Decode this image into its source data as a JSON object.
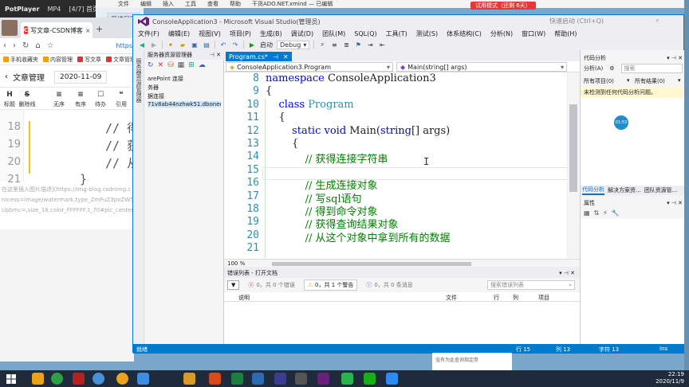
{
  "potplayer": {
    "name": "PotPlayer",
    "format": "MP4",
    "episode": "[4/7] 首页 -"
  },
  "mindmap": {
    "menus": [
      "文件",
      "编辑",
      "插入",
      "工具",
      "查看",
      "帮助"
    ],
    "file": "干货ADO.NET.xmind — 已编辑",
    "trial": "试用模式（还剩 6天）",
    "chip": "思维导图"
  },
  "browser": {
    "tab_title": "写文章-CSDN博客",
    "tab_close": "×",
    "new_tab": "+",
    "url": "https",
    "nav_icons": [
      "‹",
      "›",
      "↻",
      "⌂",
      "☆"
    ],
    "bookmarks": [
      "手机收藏夹",
      "内容管理",
      "写文章",
      "文章管理"
    ],
    "article_label": "文章管理",
    "back_symbol": "‹",
    "date": "2020-11-09",
    "tools": [
      {
        "icon": "H",
        "label": "标题"
      },
      {
        "icon": "S",
        "label": "删除线"
      },
      {
        "icon": "≡",
        "label": "无序"
      },
      {
        "icon": "≡",
        "label": "有序"
      },
      {
        "icon": "☐",
        "label": "待办"
      },
      {
        "icon": "❝",
        "label": "引用"
      }
    ],
    "editor_lines": [
      {
        "num": "18",
        "code": "// 得"
      },
      {
        "num": "19",
        "code": "// 获"
      },
      {
        "num": "20",
        "code": "// 从"
      },
      {
        "num": "21",
        "code": "}"
      }
    ],
    "md_lines": [
      "在这里插入图片描述](https://img-blog.csdnimg.c",
      "rocess=image/watermark,type_ZmFuZ3poZW5n",
      "Upbmc=,size_16,color_FFFFFF,t_70#pic_center"
    ]
  },
  "vs": {
    "title": "ConsoleApplication3 - Microsoft Visual Studio(管理员)",
    "quick_launch": "快速启动 (Ctrl+Q)",
    "menu": [
      "文件(F)",
      "编辑(E)",
      "视图(V)",
      "项目(P)",
      "生成(B)",
      "调试(D)",
      "团队(M)",
      "SQL(Q)",
      "工具(T)",
      "测试(S)",
      "体系结构(C)",
      "分析(N)",
      "窗口(W)",
      "帮助(H)"
    ],
    "toolbar": {
      "start": "启动",
      "config": "Debug"
    },
    "vstrip": "服务器资源管理器",
    "server_explorer": {
      "header": "服务器资源管理器",
      "items": [
        "arePoint 连接",
        "务器",
        "据连接",
        "71v8ab44nzhwk51.dboneon"
      ]
    },
    "editor": {
      "tab": "Program.cs*",
      "nav_left": "ConsoleApplication3.Program",
      "nav_right": "Main(string[] args)",
      "lines": [
        {
          "num": "8",
          "tokens": [
            {
              "t": "namespace ",
              "c": "kw"
            },
            {
              "t": "ConsoleApplication3",
              "c": ""
            }
          ]
        },
        {
          "num": "9",
          "tokens": [
            {
              "t": "{",
              "c": ""
            }
          ]
        },
        {
          "num": "10",
          "tokens": [
            {
              "t": "    class ",
              "c": "kw"
            },
            {
              "t": "Program",
              "c": "ty"
            }
          ]
        },
        {
          "num": "11",
          "tokens": [
            {
              "t": "    {",
              "c": ""
            }
          ]
        },
        {
          "num": "12",
          "tokens": [
            {
              "t": "        static void ",
              "c": "kw"
            },
            {
              "t": "Main(",
              "c": ""
            },
            {
              "t": "string",
              "c": "kw"
            },
            {
              "t": "[] args)",
              "c": ""
            }
          ]
        },
        {
          "num": "13",
          "tokens": [
            {
              "t": "        {",
              "c": ""
            }
          ]
        },
        {
          "num": "14",
          "tokens": [
            {
              "t": "            // 获得连接字符串",
              "c": "cm"
            }
          ]
        },
        {
          "num": "15",
          "tokens": []
        },
        {
          "num": "16",
          "tokens": [
            {
              "t": "            // 生成连接对象",
              "c": "cm"
            }
          ]
        },
        {
          "num": "17",
          "tokens": [
            {
              "t": "            // 写sql语句",
              "c": "cm"
            }
          ]
        },
        {
          "num": "18",
          "tokens": [
            {
              "t": "            // 得到命令对象",
              "c": "cm"
            }
          ]
        },
        {
          "num": "19",
          "tokens": [
            {
              "t": "            // 获得查询结果对象",
              "c": "cm"
            }
          ]
        },
        {
          "num": "20",
          "tokens": [
            {
              "t": "            // 从这个对象中拿到所有的数据",
              "c": "cm"
            }
          ]
        },
        {
          "num": "21",
          "tokens": []
        }
      ],
      "caret": "I",
      "zoom": "100 %"
    },
    "error_list": {
      "header": "错误列表 - 打开文档",
      "errors": "0，共 0 个错误",
      "warnings": "0，共 1 个警告",
      "messages": "0，共 0 条消息",
      "search": "搜索错误列表",
      "columns": [
        "说明",
        "文件",
        "行",
        "列",
        "项目"
      ]
    },
    "code_analysis": {
      "header": "代码分析",
      "analyze": "分析(A)",
      "search": "搜索",
      "scope": "所有项目(0)",
      "results": "所有结果(0)",
      "message": "未检测到任何代码分析问题。",
      "badge": "01:53",
      "tabs": [
        "代码分析",
        "解决方案资...",
        "团队资源管..."
      ]
    },
    "properties": {
      "header": "属性",
      "tools": [
        "▦",
        "⇅",
        "⚡",
        "🔧"
      ]
    },
    "status": {
      "ready": "就绪",
      "line": "行 15",
      "col": "列 13",
      "char": "字符 13",
      "ins": "Ins"
    }
  },
  "behind_window": {
    "text": "没有为此查询指定参"
  },
  "taskbar": {
    "time": "22:19",
    "date": "2020/11/9"
  },
  "colors": {
    "vs_blue": "#007acc",
    "keyword": "#0000ff",
    "type": "#2b91af",
    "comment": "#008000"
  }
}
